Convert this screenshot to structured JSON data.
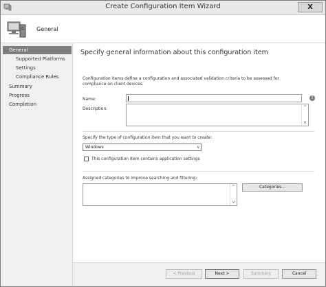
{
  "window": {
    "title": "Create Configuration Item Wizard",
    "close_glyph": "X"
  },
  "header": {
    "title": "General"
  },
  "sidebar": {
    "items": [
      {
        "label": "General",
        "active": true
      },
      {
        "label": "Supported Platforms",
        "active": false
      },
      {
        "label": "Settings",
        "active": false
      },
      {
        "label": "Compliance Rules",
        "active": false
      },
      {
        "label": "Summary",
        "active": false
      },
      {
        "label": "Progress",
        "active": false
      },
      {
        "label": "Completion",
        "active": false
      }
    ]
  },
  "main": {
    "page_title": "Specify general information about this configuration item",
    "description": "Configuration items define a configuration and associated validation criteria to be assessed for compliance on client devices.",
    "name_label": "Name:",
    "name_value": "",
    "description_label": "Description:",
    "description_value": "",
    "type_label": "Specify the type of configuration item that you want to create:",
    "type_selected": "Windows",
    "app_settings_label": "This configuration item contains application settings",
    "app_settings_checked": false,
    "categories_label": "Assigned categories to improve searching and filtering:",
    "categories_button": "Categories..."
  },
  "footer": {
    "previous": "< Previous",
    "next": "Next >",
    "summary": "Summary",
    "cancel": "Cancel"
  },
  "icons": {
    "info": "!",
    "scroll_up": "^",
    "scroll_down": "v",
    "dropdown": "v"
  }
}
